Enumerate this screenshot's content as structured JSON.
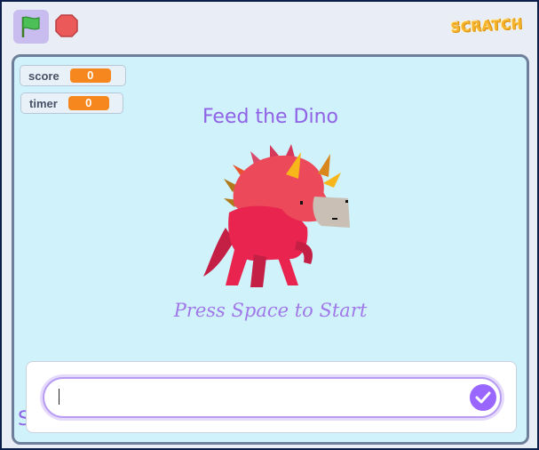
{
  "app": {
    "logo_text": "SCRATCH",
    "green_flag_icon": "green-flag-icon",
    "stop_icon": "stop-sign-icon"
  },
  "monitors": [
    {
      "label": "score",
      "value": "0"
    },
    {
      "label": "timer",
      "value": "0"
    }
  ],
  "stage": {
    "title": "Feed the Dino",
    "prompt": "Press Space to Start",
    "partial_text": "S                   s",
    "sprite_icon": "dino-icon"
  },
  "ask": {
    "value": "",
    "submit_icon": "checkmark-icon"
  },
  "colors": {
    "accent": "#9966ff",
    "title": "#8f62e6",
    "monitor_value": "#f6861e",
    "stage_bg": "#d0f2fb"
  }
}
